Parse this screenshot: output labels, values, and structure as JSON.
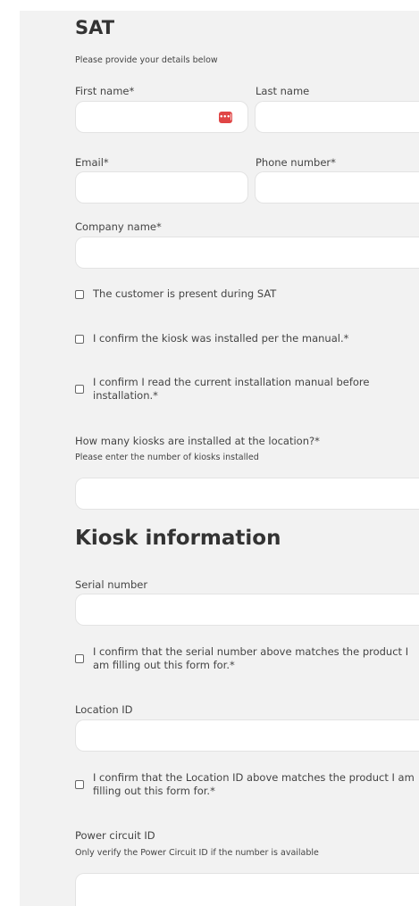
{
  "form": {
    "title": "SAT",
    "subtitle": "Please provide your details below",
    "first_name_label": "First name*",
    "last_name_label": "Last name",
    "email_label": "Email*",
    "phone_label": "Phone number*",
    "company_label": "Company name*",
    "check_customer_present": "The customer is present during SAT",
    "check_installed_per_manual": "I confirm the kiosk was installed per the manual.*",
    "check_read_manual": "I confirm I read the current installation manual before installation.*",
    "kiosk_count_label": "How many kiosks are installed at the location?*",
    "kiosk_count_help": "Please enter the number of kiosks installed"
  },
  "kiosk": {
    "title": "Kiosk information",
    "serial_label": "Serial number",
    "check_serial_matches": "I confirm that the serial number above matches the product I am filling out this form for.*",
    "location_label": "Location ID",
    "check_location_matches": "I confirm that the Location ID above matches the product I am filling out this form for.*",
    "power_label": "Power circuit ID",
    "power_help": "Only verify the Power Circuit ID if the number is available"
  },
  "icons": {
    "password_manager": "password-manager-icon",
    "password_manager_glyph": "•••|",
    "password_manager_color": "#e04545"
  }
}
